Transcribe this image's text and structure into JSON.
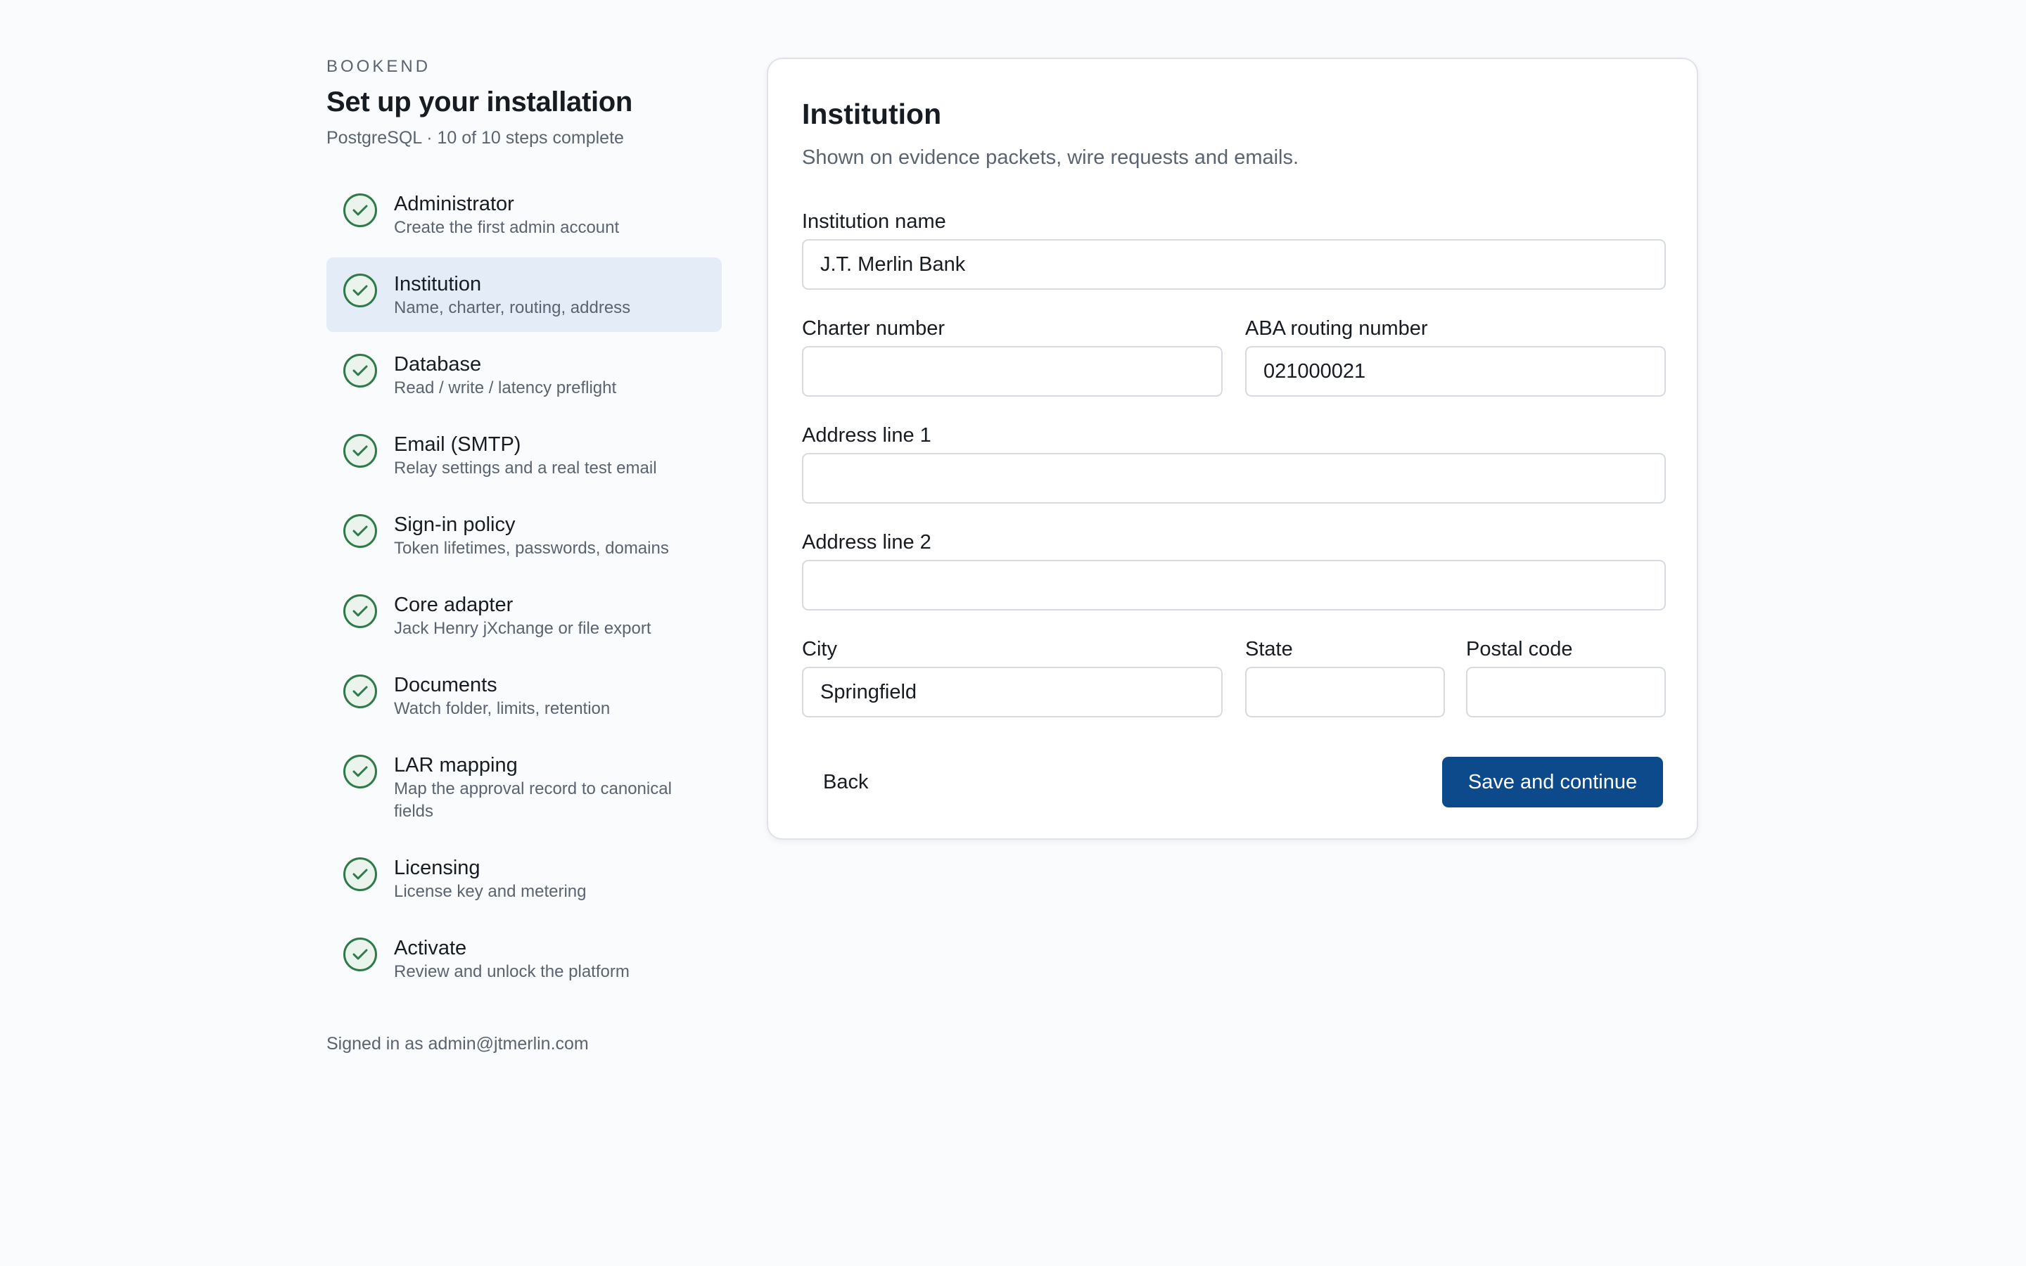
{
  "brand": "BOOKEND",
  "title": "Set up your installation",
  "subtitle": "PostgreSQL · 10 of 10 steps complete",
  "steps": [
    {
      "label": "Administrator",
      "desc": "Create the first admin account",
      "status": "complete"
    },
    {
      "label": "Institution",
      "desc": "Name, charter, routing, address",
      "status": "complete",
      "active": true
    },
    {
      "label": "Database",
      "desc": "Read / write / latency preflight",
      "status": "complete"
    },
    {
      "label": "Email (SMTP)",
      "desc": "Relay settings and a real test email",
      "status": "complete"
    },
    {
      "label": "Sign-in policy",
      "desc": "Token lifetimes, passwords, domains",
      "status": "complete"
    },
    {
      "label": "Core adapter",
      "desc": "Jack Henry jXchange or file export",
      "status": "complete"
    },
    {
      "label": "Documents",
      "desc": "Watch folder, limits, retention",
      "status": "complete"
    },
    {
      "label": "LAR mapping",
      "desc": "Map the approval record to canonical fields",
      "status": "complete"
    },
    {
      "label": "Licensing",
      "desc": "License key and metering",
      "status": "complete"
    },
    {
      "label": "Activate",
      "desc": "Review and unlock the platform",
      "status": "complete"
    }
  ],
  "signed_in": "Signed in as admin@jtmerlin.com",
  "form": {
    "title": "Institution",
    "subtitle": "Shown on evidence packets, wire requests and emails.",
    "institution_name": {
      "label": "Institution name",
      "value": "J.T. Merlin Bank"
    },
    "charter_number": {
      "label": "Charter number",
      "value": ""
    },
    "aba_routing": {
      "label": "ABA routing number",
      "value": "021000021"
    },
    "address1": {
      "label": "Address line 1",
      "value": ""
    },
    "address2": {
      "label": "Address line 2",
      "value": ""
    },
    "city": {
      "label": "City",
      "value": "Springfield"
    },
    "state": {
      "label": "State",
      "value": ""
    },
    "postal": {
      "label": "Postal code",
      "value": ""
    },
    "back_label": "Back",
    "save_label": "Save and continue"
  },
  "colors": {
    "accent": "#0c4a8c",
    "active_step_bg": "#e3ecf7",
    "check_green": "#2f7a4a"
  },
  "icons": {
    "step_complete": "check-circle-icon"
  }
}
